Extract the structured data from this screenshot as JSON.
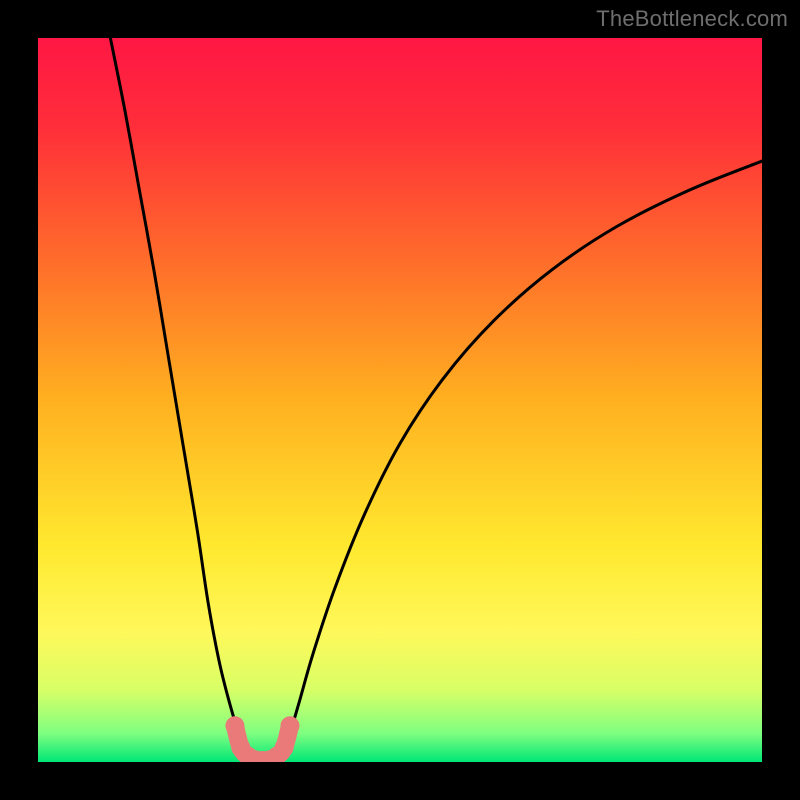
{
  "watermark": "TheBottleneck.com",
  "colors": {
    "page_bg": "#000000",
    "gradient_stops": [
      {
        "offset": 0.0,
        "color": "#ff1744"
      },
      {
        "offset": 0.12,
        "color": "#ff2d3a"
      },
      {
        "offset": 0.3,
        "color": "#ff6a2b"
      },
      {
        "offset": 0.5,
        "color": "#ffb020"
      },
      {
        "offset": 0.7,
        "color": "#ffe82e"
      },
      {
        "offset": 0.82,
        "color": "#fff85a"
      },
      {
        "offset": 0.9,
        "color": "#d8ff66"
      },
      {
        "offset": 0.96,
        "color": "#80ff80"
      },
      {
        "offset": 1.0,
        "color": "#00e676"
      }
    ],
    "curve": "#000000",
    "marker_fill": "#ea7a7a",
    "marker_stroke": "#d05858"
  },
  "chart_data": {
    "type": "line",
    "title": "",
    "xlabel": "",
    "ylabel": "",
    "xlim": [
      0,
      100
    ],
    "ylim": [
      0,
      100
    ],
    "grid": false,
    "legend": false,
    "series": [
      {
        "name": "left-curve",
        "x": [
          10.0,
          12.0,
          14.0,
          16.0,
          18.0,
          20.0,
          22.0,
          23.5,
          25.0,
          26.5,
          28.0,
          28.8
        ],
        "y": [
          100.0,
          90.0,
          79.0,
          68.0,
          56.0,
          44.0,
          32.0,
          22.0,
          14.0,
          8.0,
          3.0,
          0.5
        ]
      },
      {
        "name": "right-curve",
        "x": [
          33.5,
          34.5,
          36.0,
          38.0,
          41.0,
          45.0,
          50.0,
          56.0,
          63.0,
          71.0,
          80.0,
          90.0,
          100.0
        ],
        "y": [
          0.5,
          3.0,
          8.0,
          15.0,
          24.0,
          34.0,
          44.0,
          53.0,
          61.0,
          68.0,
          74.0,
          79.0,
          83.0
        ]
      }
    ],
    "markers": {
      "name": "valley-markers",
      "x": [
        27.2,
        28.0,
        29.0,
        30.0,
        31.0,
        32.0,
        33.0,
        34.0,
        34.8
      ],
      "y": [
        5.0,
        2.0,
        0.8,
        0.3,
        0.2,
        0.3,
        0.8,
        2.0,
        5.0
      ]
    }
  }
}
